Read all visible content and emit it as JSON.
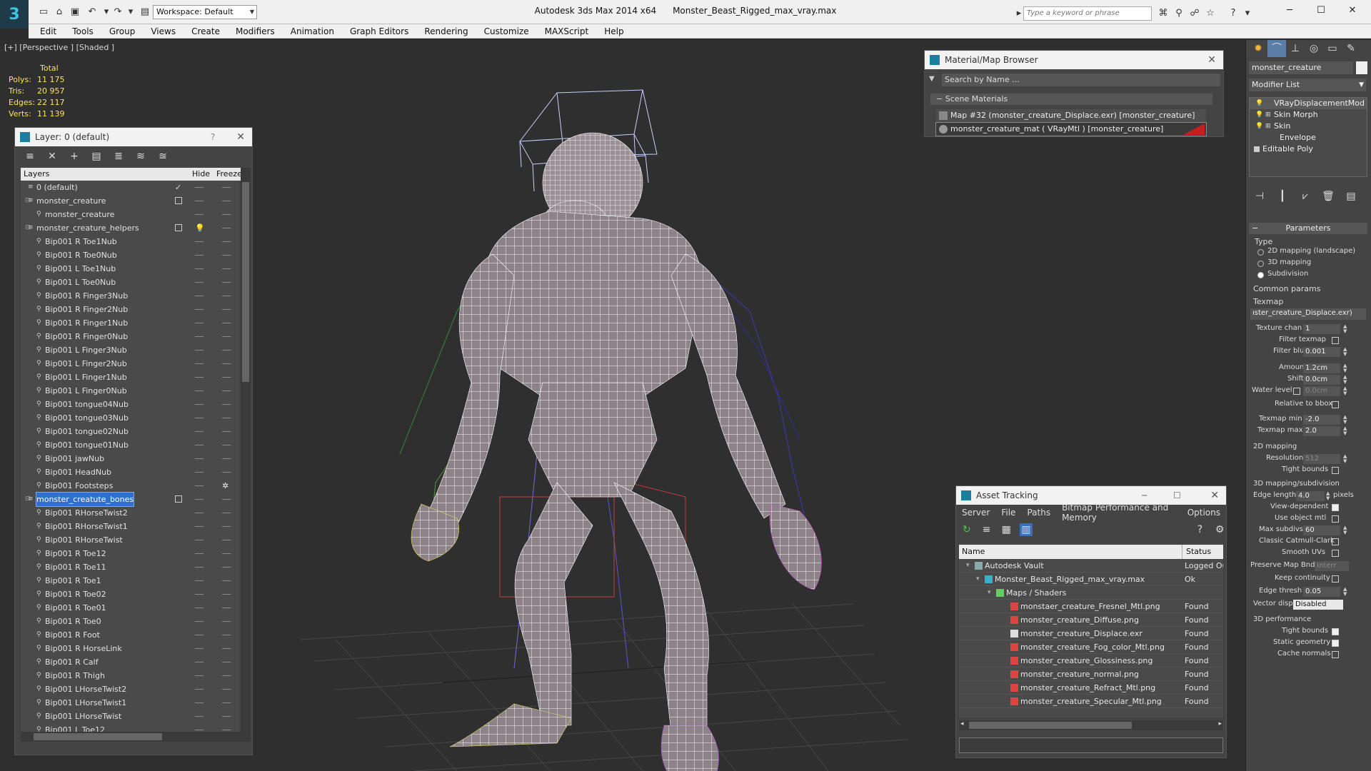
{
  "window": {
    "app_title": "Autodesk 3ds Max  2014 x64",
    "file_title": "Monster_Beast_Rigged_max_vray.max",
    "workspace": "Workspace: Default",
    "search_placeholder": "Type a keyword or phrase"
  },
  "menu": [
    "Edit",
    "Tools",
    "Group",
    "Views",
    "Create",
    "Modifiers",
    "Animation",
    "Graph Editors",
    "Rendering",
    "Customize",
    "MAXScript",
    "Help"
  ],
  "viewport": {
    "label": "[+] [Perspective ] [Shaded ]",
    "stats_header": "Total",
    "stats": [
      {
        "label": "Polys:",
        "value": "11 175"
      },
      {
        "label": "Tris:",
        "value": "20 957"
      },
      {
        "label": "Edges:",
        "value": "22 117"
      },
      {
        "label": "Verts:",
        "value": "11 139"
      }
    ]
  },
  "layer_panel": {
    "title": "Layer: 0 (default)",
    "help": "?",
    "col_layers": "Layers",
    "col_hide": "Hide",
    "col_freeze": "Freeze",
    "rows": [
      "0 (default)",
      "monster_creature",
      "monster_creature",
      "monster_creature_helpers",
      "Bip001 R Toe1Nub",
      "Bip001 R Toe0Nub",
      "Bip001 L Toe1Nub",
      "Bip001 L Toe0Nub",
      "Bip001 R Finger3Nub",
      "Bip001 R Finger2Nub",
      "Bip001 R Finger1Nub",
      "Bip001 R Finger0Nub",
      "Bip001 L Finger3Nub",
      "Bip001 L Finger2Nub",
      "Bip001 L Finger1Nub",
      "Bip001 L Finger0Nub",
      "Bip001 tongue04Nub",
      "Bip001 tongue03Nub",
      "Bip001 tongue02Nub",
      "Bip001 tongue01Nub",
      "Bip001 jawNub",
      "Bip001 HeadNub",
      "Bip001 Footsteps",
      "monster_creatute_bones",
      "Bip001 RHorseTwist2",
      "Bip001 RHorseTwist1",
      "Bip001 RHorseTwist",
      "Bip001 R Toe12",
      "Bip001 R Toe11",
      "Bip001 R Toe1",
      "Bip001 R Toe02",
      "Bip001 R Toe01",
      "Bip001 R Toe0",
      "Bip001 R Foot",
      "Bip001 R HorseLink",
      "Bip001 R Calf",
      "Bip001 R Thigh",
      "Bip001 LHorseTwist2",
      "Bip001 LHorseTwist1",
      "Bip001 LHorseTwist",
      "Bip001 L Toe12"
    ]
  },
  "material_browser": {
    "title": "Material/Map Browser",
    "search": "Search by Name ...",
    "section": "Scene Materials",
    "items": [
      "Map #32 (monster_creature_Displace.exr)  [monster_creature]",
      "monster_creature_mat  ( VRayMtl )  [monster_creature]"
    ]
  },
  "asset_tracking": {
    "title": "Asset Tracking",
    "menu": [
      "Server",
      "File",
      "Paths",
      "Bitmap Performance and Memory",
      "Options"
    ],
    "col_name": "Name",
    "col_status": "Status",
    "rows": [
      {
        "name": "Autodesk Vault",
        "status": "Logged Ou"
      },
      {
        "name": "Monster_Beast_Rigged_max_vray.max",
        "status": "Ok"
      },
      {
        "name": "Maps / Shaders",
        "status": ""
      },
      {
        "name": "monstaer_creature_Fresnel_Mtl.png",
        "status": "Found"
      },
      {
        "name": "monster_creature_Diffuse.png",
        "status": "Found"
      },
      {
        "name": "monster_creature_Displace.exr",
        "status": "Found"
      },
      {
        "name": "monster_creature_Fog_color_Mtl.png",
        "status": "Found"
      },
      {
        "name": "monster_creature_Glossiness.png",
        "status": "Found"
      },
      {
        "name": "monster_creature_normal.png",
        "status": "Found"
      },
      {
        "name": "monster_creature_Refract_Mtl.png",
        "status": "Found"
      },
      {
        "name": "monster_creature_Specular_Mtl.png",
        "status": "Found"
      }
    ]
  },
  "command_panel": {
    "object_name": "monster_creature",
    "modifier_list": "Modifier List",
    "stack": [
      "VRayDisplacementMod",
      "Skin Morph",
      "Skin",
      "Envelope",
      "Editable Poly"
    ],
    "parameters": "Parameters",
    "type_label": "Type",
    "type_options": [
      "2D mapping (landscape)",
      "3D mapping",
      "Subdivision"
    ],
    "common_params": "Common params",
    "texmap_label": "Texmap",
    "texmap_value": "ıster_creature_Displace.exr)",
    "texture_chan_label": "Texture chan",
    "texture_chan": "1",
    "filter_texmap": "Filter texmap",
    "filter_blur_label": "Filter blur",
    "filter_blur": "0.001",
    "amount_label": "Amount",
    "amount": "1.2cm",
    "shift_label": "Shift",
    "shift": "0.0cm",
    "water_level_label": "Water level",
    "water_level": "0.0cm",
    "relative_bbox": "Relative to bbox",
    "texmap_min_label": "Texmap min",
    "texmap_min": "-2.0",
    "texmap_max_label": "Texmap max",
    "texmap_max": "2.0",
    "mapping2d": "2D mapping",
    "resolution_label": "Resolution",
    "resolution": "512",
    "tight_bounds": "Tight bounds",
    "mapping3d": "3D mapping/subdivision",
    "edge_length_label": "Edge length",
    "edge_length": "4.0",
    "pixels": "pixels",
    "view_dependent": "View-dependent",
    "use_object_mtl": "Use object mtl",
    "max_subdivs_label": "Max subdivs",
    "max_subdivs": "60",
    "classic_catmull": "Classic Catmull-Clark",
    "smooth_uvs": "Smooth UVs",
    "preserve_map_bnd": "Preserve Map Bnd",
    "preserve_value": "Interr",
    "keep_continuity": "Keep continuity",
    "edge_thresh_label": "Edge thresh",
    "edge_thresh": "0.05",
    "vector_displ_label": "Vector displ",
    "vector_displ": "Disabled",
    "performance": "3D performance",
    "perf_tight_bounds": "Tight bounds",
    "static_geometry": "Static geometry",
    "cache_normals": "Cache normals"
  }
}
